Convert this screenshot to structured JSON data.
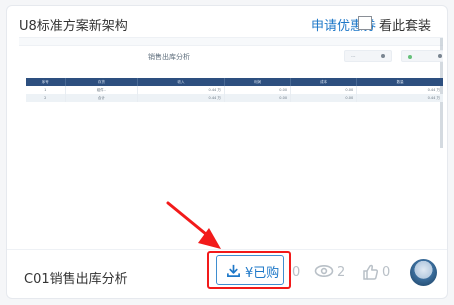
{
  "header": {
    "title": "U8标准方案新架构",
    "apply_coupon": "申请优惠券",
    "view_suite": "看此套装"
  },
  "preview": {
    "report_title": "销售出库分析",
    "table_headers": [
      "序号",
      "存货",
      "收入",
      "利润",
      "成本",
      "数量"
    ],
    "table_rows": [
      [
        "1",
        "组件..",
        "0.44 万",
        "0.00",
        "0.00",
        "0.44 万"
      ],
      [
        "2",
        "合计",
        "0.44 万",
        "0.00",
        "0.00",
        "0.44 万"
      ]
    ]
  },
  "footer": {
    "item_title": "C01销售出库分析",
    "purchase_label": "¥已购",
    "left_count": "0",
    "view_count": "2",
    "like_count": "0"
  },
  "icons": {
    "download": "download-icon",
    "eye": "eye-icon",
    "thumb": "thumbs-up-icon",
    "arrow": "red-pointer-arrow"
  },
  "colors": {
    "accent": "#1e78c8",
    "highlight": "#f21a1a",
    "table_header": "#2d4f7f"
  }
}
